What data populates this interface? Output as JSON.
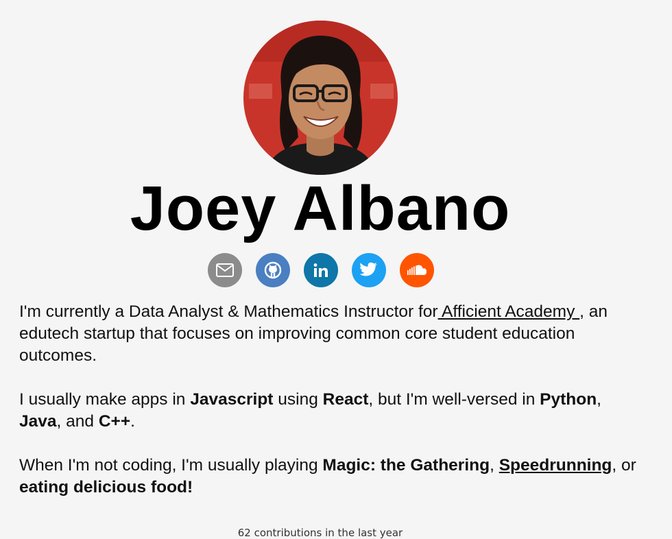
{
  "profile": {
    "name": "Joey Albano"
  },
  "socials": [
    {
      "id": "email",
      "icon": "mail-icon",
      "color": "#8c8c8c"
    },
    {
      "id": "github",
      "icon": "github-icon",
      "color": "#4a7fc1"
    },
    {
      "id": "linkedin",
      "icon": "linkedin-icon",
      "color": "#0e76a8"
    },
    {
      "id": "twitter",
      "icon": "twitter-icon",
      "color": "#1da1f2"
    },
    {
      "id": "soundcloud",
      "icon": "soundcloud-icon",
      "color": "#ff5500"
    }
  ],
  "bio": {
    "p1": {
      "t1": "I'm currently a Data Analyst & Mathematics Instructor for",
      "link": " Afficient Academy ",
      "t2": ", an edutech startup that focuses on improving common core student education outcomes."
    },
    "p2": {
      "t1": "I usually make apps in ",
      "b1": "Javascript",
      "t2": " using ",
      "b2": "React",
      "t3": ", but I'm well-versed in ",
      "b3": "Python",
      "t4": ", ",
      "b4": "Java",
      "t5": ", and ",
      "b5": "C++",
      "t6": "."
    },
    "p3": {
      "t1": "When I'm not coding, I'm usually playing ",
      "b1": "Magic: the Gathering",
      "t2": ", ",
      "link": "Speedrunning",
      "t3": ", or ",
      "b2": "eating delicious food!"
    }
  },
  "contributions": {
    "text": "62 contributions in the last year"
  }
}
